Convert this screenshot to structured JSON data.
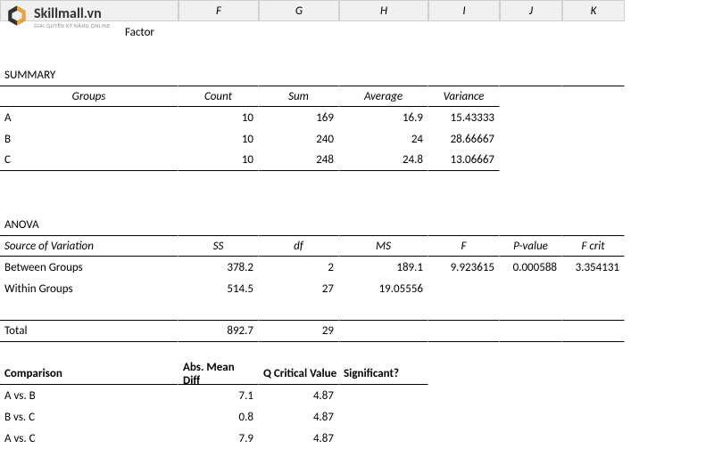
{
  "logo": {
    "brand": "Skillmall.vn",
    "tagline": "GIAI QUYẾN KỸ NĂNG ONLINE"
  },
  "colheaders": {
    "F": "F",
    "G": "G",
    "H": "H",
    "I": "I",
    "J": "J",
    "K": "K"
  },
  "row1": {
    "factor": "Factor"
  },
  "summary": {
    "title": "SUMMARY",
    "headers": {
      "groups": "Groups",
      "count": "Count",
      "sum": "Sum",
      "average": "Average",
      "variance": "Variance"
    },
    "rows": [
      {
        "group": "A",
        "count": "10",
        "sum": "169",
        "avg": "16.9",
        "var": "15.43333"
      },
      {
        "group": "B",
        "count": "10",
        "sum": "240",
        "avg": "24",
        "var": "28.66667"
      },
      {
        "group": "C",
        "count": "10",
        "sum": "248",
        "avg": "24.8",
        "var": "13.06667"
      }
    ]
  },
  "anova": {
    "title": "ANOVA",
    "headers": {
      "src": "Source of Variation",
      "ss": "SS",
      "df": "df",
      "ms": "MS",
      "f": "F",
      "pval": "P-value",
      "fcrit": "F crit"
    },
    "rows": [
      {
        "src": "Between Groups",
        "ss": "378.2",
        "df": "2",
        "ms": "189.1",
        "f": "9.923615",
        "pval": "0.000588",
        "fcrit": "3.354131"
      },
      {
        "src": "Within Groups",
        "ss": "514.5",
        "df": "27",
        "ms": "19.05556",
        "f": "",
        "pval": "",
        "fcrit": ""
      }
    ],
    "total": {
      "label": "Total",
      "ss": "892.7",
      "df": "29"
    }
  },
  "comparison": {
    "title": "Comparison",
    "headers": {
      "diff": "Abs. Mean Diff",
      "qcrit": "Q Critical Value",
      "sig": "Significant?"
    },
    "rows": [
      {
        "label": "A vs. B",
        "diff": "7.1",
        "qcrit": "4.87"
      },
      {
        "label": "B vs. C",
        "diff": "0.8",
        "qcrit": "4.87"
      },
      {
        "label": "A vs. C",
        "diff": "7.9",
        "qcrit": "4.87"
      }
    ]
  }
}
